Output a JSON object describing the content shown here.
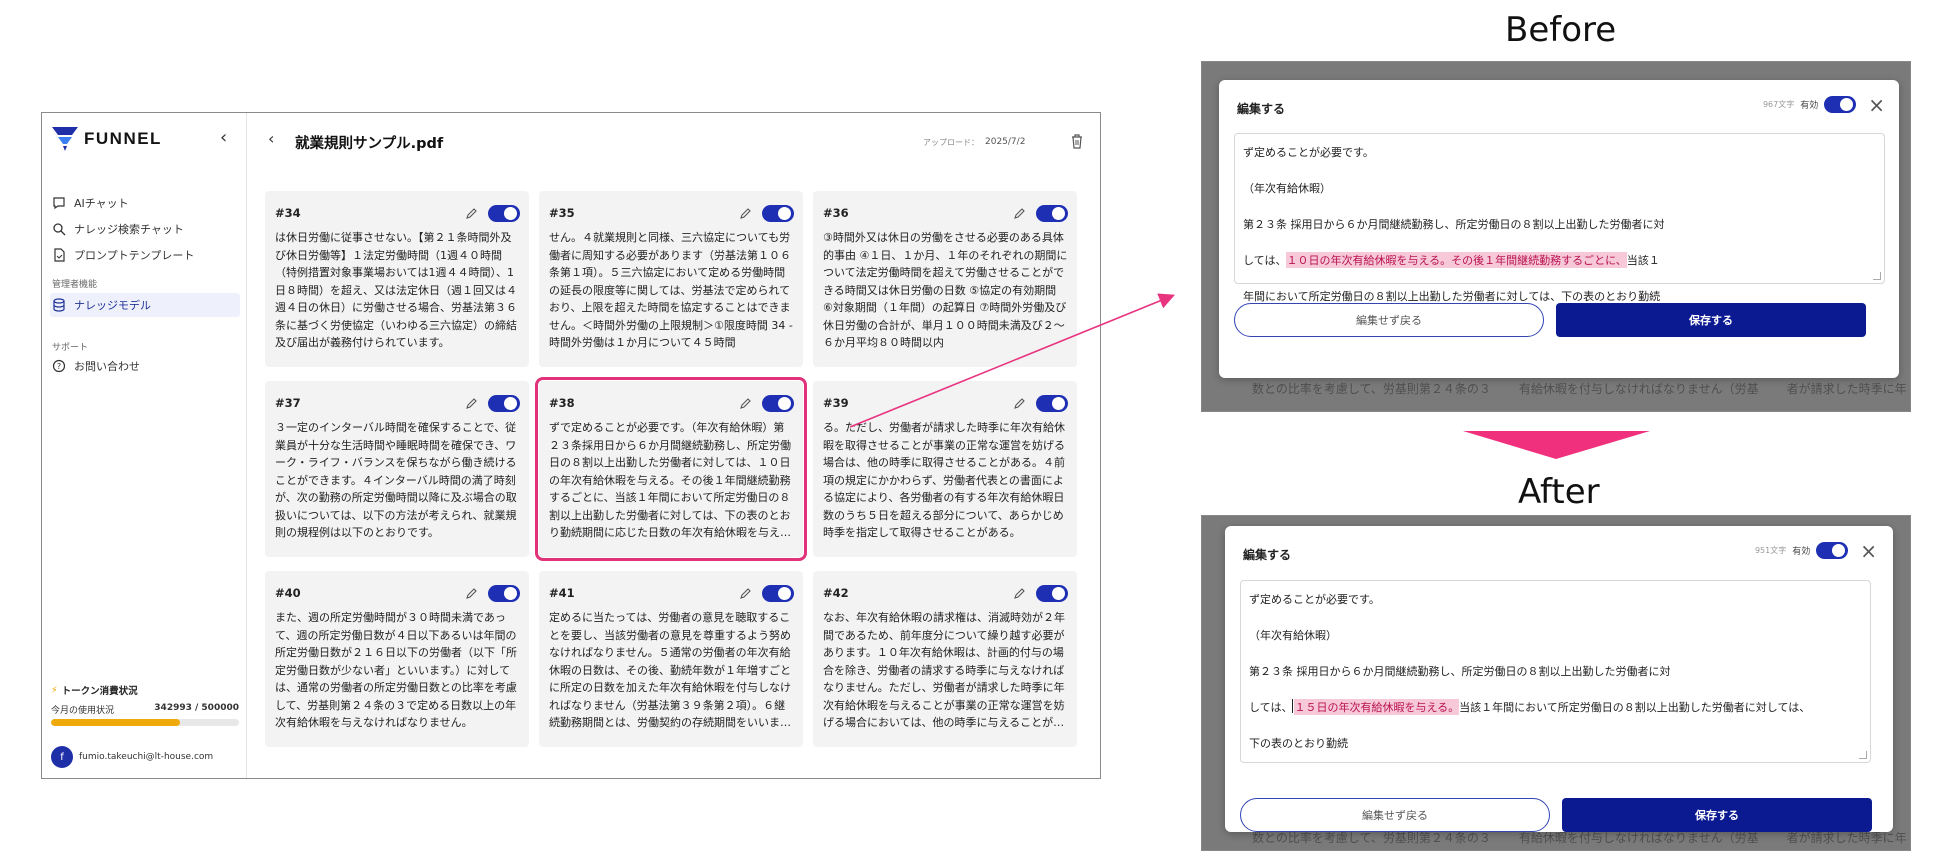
{
  "sidebar": {
    "brand": "FUNNEL",
    "collapse_icon": "chevron-left-icon",
    "items": [
      {
        "label": "AIチャット",
        "icon": "chat-icon"
      },
      {
        "label": "ナレッジ検索チャット",
        "icon": "search-icon"
      },
      {
        "label": "プロンプトテンプレート",
        "icon": "document-icon"
      }
    ],
    "admin_section": "管理者機能",
    "admin_items": [
      {
        "label": "ナレッジモデル",
        "icon": "database-icon",
        "active": true
      }
    ],
    "support_section": "サポート",
    "support_items": [
      {
        "label": "お問い合わせ",
        "icon": "help-icon"
      }
    ],
    "token": {
      "title": "トークン消費状況",
      "month_label": "今月の使用状況",
      "usage": "342993 / 500000",
      "used": 342993,
      "limit": 500000,
      "bar_color": "#f0a90a"
    },
    "user": {
      "initial": "f",
      "email": "fumio.takeuchi@lt-house.com"
    }
  },
  "main": {
    "title": "就業規則サンプル.pdf",
    "upload_label": "アップロード：",
    "upload_date": "2025/7/2",
    "cards": [
      {
        "num": "#34",
        "text": "は休日労働に従事させない。【第２１条時間外及び休日労働等】１法定労働時間（1週４０時間（特例措置対象事業場おいては1週４４時間）、1日８時間）を超え、又は法定休日（週１回又は４週４日の休日）に労働させる場合、労基法第３６条に基づく労使協定（いわゆる三六協定）の締結及び届出が義務付けられています。"
      },
      {
        "num": "#35",
        "text": "せん。４就業規則と同様、三六協定についても労働者に周知する必要があります（労基法第１０６条第１項）。５三六協定において定める労働時間の延長の限度等に関しては、労基法で定められており、上限を超えた時間を協定することはできません。＜時間外労働の上限規制＞①限度時間 34 - 時間外労働は１か月について４５時間"
      },
      {
        "num": "#36",
        "text": "③時間外又は休日の労働をさせる必要のある具体的事由 ④１日、１か月、１年のそれぞれの期間について法定労働時間を超えて労働させることができる時間又は休日労働の日数 ⑤協定の有効期間 ⑥対象期間（１年間）の起算日 ⑦時間外労働及び休日労働の合計が、単月１００時間未満及び２〜６か月平均８０時間以内"
      },
      {
        "num": "#37",
        "text": "３一定のインターバル時間を確保することで、従業員が十分な生活時間や睡眠時間を確保でき、ワーク・ライフ・バランスを保ちながら働き続けることができます。４インターバル時間の満了時刻が、次の勤務の所定労働時間以降に及ぶ場合の取扱いについては、以下の方法が考えられ、就業規則の規程例は以下のとおりです。"
      },
      {
        "num": "#38",
        "text": "ずで定めることが必要です。（年次有給休暇）第２３条採用日から６か月間継続勤務し、所定労働日の８割以上出勤した労働者に対しては、１０日の年次有給休暇を与える。その後１年間継続勤務するごとに、当該１年間において所定労働日の８割以上出勤した労働者に対しては、下の表のとおり勤続期間に応じた日数の年次有給休暇を与える。",
        "selected": true
      },
      {
        "num": "#39",
        "text": "る。ただし、労働者が請求した時季に年次有給休暇を取得させることが事業の正常な運営を妨げる場合は、他の時季に取得させることがある。４前項の規定にかかわらず、労働者代表との書面による協定により、各労働者の有する年次有給休暇日数のうち５日を超える部分について、あらかじめ時季を指定して取得させることがある。"
      },
      {
        "num": "#40",
        "text": "また、週の所定労働時間が３０時間未満であって、週の所定労働日数が４日以下あるいは年間の所定労働日数が２１６日以下の労働者（以下「所定労働日数が少ない者」といいます。）に対しては、通常の労働者の所定労働日数との比率を考慮して、労基則第２４条の３で定める日数以上の年次有給休暇を与えなければなりません。"
      },
      {
        "num": "#41",
        "text": "定めるに当たっては、労働者の意見を聴取することを要し、当該労働者の意見を尊重するよう努めなければなりません。５通常の労働者の年次有給休暇の日数は、その後、勤続年数が１年増すごとに所定の日数を加えた年次有給休暇を付与しなければなりません（労基法第３９条第２項）。６継続勤務期間とは、労働契約の存続期間をいいます。"
      },
      {
        "num": "#42",
        "text": "なお、年次有給休暇の請求権は、消滅時効が２年間であるため、前年度分について繰り越す必要があります。１０年次有給休暇は、計画的付与の場合を除き、労働者の請求する時季に与えなければなりません。ただし、労働者が請求した時季に年次有給休暇を与えることが事業の正常な運営を妨げる場合においては、他の時季に与えることができます。"
      }
    ]
  },
  "before": {
    "heading": "Before",
    "modal_title": "編集する",
    "char_count": "967文字",
    "valid_label": "有効",
    "lines": [
      {
        "plain_before": "ず定めることが必要です。",
        "highlight": "",
        "plain_after": ""
      },
      {
        "plain_before": "（年次有給休暇）",
        "highlight": "",
        "plain_after": ""
      },
      {
        "plain_before": "第２３条 採用日から６か月間継続勤務し、所定労働日の８割以上出勤した労働者に対",
        "highlight": "",
        "plain_after": ""
      },
      {
        "plain_before": "しては、",
        "highlight": "１０日の年次有給休暇を与える。その後１年間継続勤務するごとに、",
        "plain_after": "当該１"
      },
      {
        "plain_before": "年間において所定労働日の８割以上出勤した労働者に対しては、下の表のとおり勤続",
        "highlight": "",
        "plain_after": ""
      }
    ],
    "cancel_label": "編集せず戻る",
    "save_label": "保存する"
  },
  "after": {
    "heading": "After",
    "modal_title": "編集する",
    "char_count": "951文字",
    "valid_label": "有効",
    "lines": [
      {
        "plain_before": "ず定めることが必要です。",
        "highlight": "",
        "plain_after": ""
      },
      {
        "plain_before": "（年次有給休暇）",
        "highlight": "",
        "plain_after": ""
      },
      {
        "plain_before": "第２３条 採用日から６か月間継続勤務し、所定労働日の８割以上出勤した労働者に対",
        "highlight": "",
        "plain_after": ""
      },
      {
        "plain_before": "しては、",
        "highlight": "１５日の年次有給休暇を与える。",
        "plain_after": "当該１年間において所定労働日の８割以上出勤した労働者に対しては、"
      },
      {
        "plain_before": "下の表のとおり勤続",
        "highlight": "",
        "plain_after": ""
      }
    ],
    "cancel_label": "編集せず戻る",
    "save_label": "保存する"
  },
  "background_snippets": {
    "before_bottom": [
      "数との比率を考慮して、労基則第２４条の３",
      "有給休暇を付与しなければなりません（労基",
      "者が請求した時季に年"
    ],
    "after_bottom": [
      "数との比率を考慮して、労基則第２４条の３",
      "有給休暇を付与しなければなりません（労基",
      "者が請求した時季に年"
    ]
  },
  "colors": {
    "accent": "#1e2fb3",
    "save_button": "#0c1a91",
    "highlight_bg": "#f7c8d8",
    "highlight_text": "#b8124f",
    "selection_outline": "#e0337a",
    "arrow": "#e8337f"
  }
}
